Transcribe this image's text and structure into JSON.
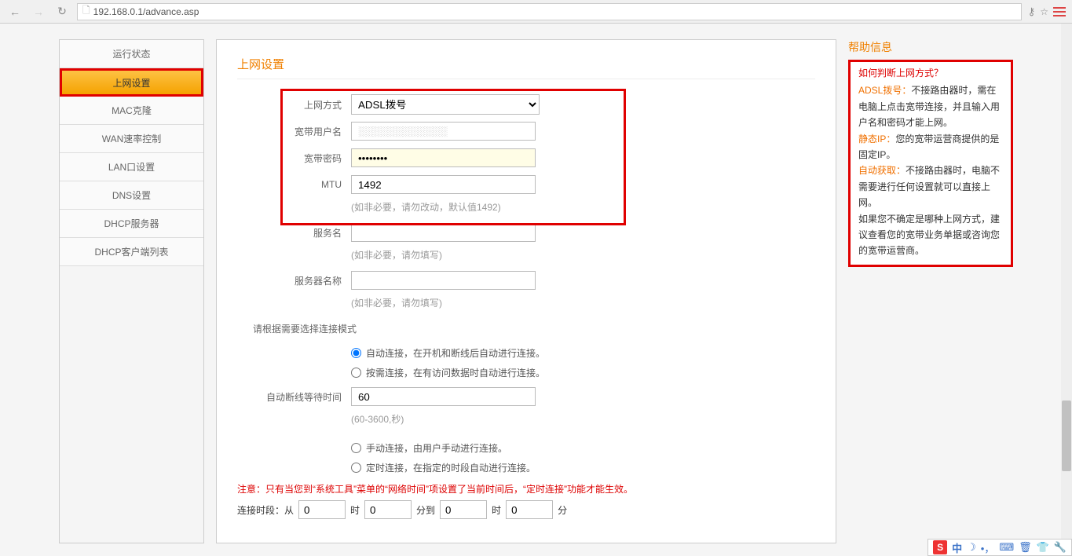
{
  "browser": {
    "url": "192.168.0.1/advance.asp"
  },
  "sidebar": {
    "items": [
      {
        "label": "运行状态"
      },
      {
        "label": "上网设置"
      },
      {
        "label": "MAC克隆"
      },
      {
        "label": "WAN速率控制"
      },
      {
        "label": "LAN口设置"
      },
      {
        "label": "DNS设置"
      },
      {
        "label": "DHCP服务器"
      },
      {
        "label": "DHCP客户端列表"
      }
    ]
  },
  "main": {
    "title": "上网设置",
    "labels": {
      "mode": "上网方式",
      "user": "宽带用户名",
      "pass": "宽带密码",
      "mtu": "MTU",
      "mtuhint": "(如非必要，请勿改动，默认值1492)",
      "service": "服务名",
      "servicehint": "(如非必要，请勿填写)",
      "server": "服务器名称",
      "serverhint": "(如非必要，请勿填写)",
      "connmode": "请根据需要选择连接模式",
      "idle": "自动断线等待时间",
      "idlehint": "(60-3600,秒)",
      "warn": "注意：只有当您到“系统工具”菜单的“网络时间”项设置了当前时间后，“定时连接”功能才能生效。",
      "time_prefix": "连接时段：从",
      "time_h": "时",
      "time_m": "分到",
      "time_m2": "分"
    },
    "values": {
      "mode": "ADSL拨号",
      "user": "░░░░░░░░░░░░",
      "pass": "••••••••",
      "mtu": "1492",
      "service": "",
      "server": "",
      "idle": "60",
      "t1": "0",
      "t2": "0",
      "t3": "0",
      "t4": "0"
    },
    "radios": {
      "r1": "自动连接，在开机和断线后自动进行连接。",
      "r2": "按需连接，在有访问数据时自动进行连接。",
      "r3": "手动连接，由用户手动进行连接。",
      "r4": "定时连接，在指定的时段自动进行连接。"
    }
  },
  "help": {
    "title": "帮助信息",
    "q": "如何判断上网方式？",
    "p1a": "ADSL拨号：",
    "p1b": "不接路由器时，需在电脑上点击宽带连接，并且输入用户名和密码才能上网。",
    "p2a": "静态IP：",
    "p2b": "您的宽带运营商提供的是固定IP。",
    "p3a": "自动获取：",
    "p3b": "不接路由器时，电脑不需要进行任何设置就可以直接上网。",
    "p4": "如果您不确定是哪种上网方式，建议查看您的宽带业务单据或咨询您的宽带运营商。"
  },
  "ime": {
    "cn": "中"
  }
}
